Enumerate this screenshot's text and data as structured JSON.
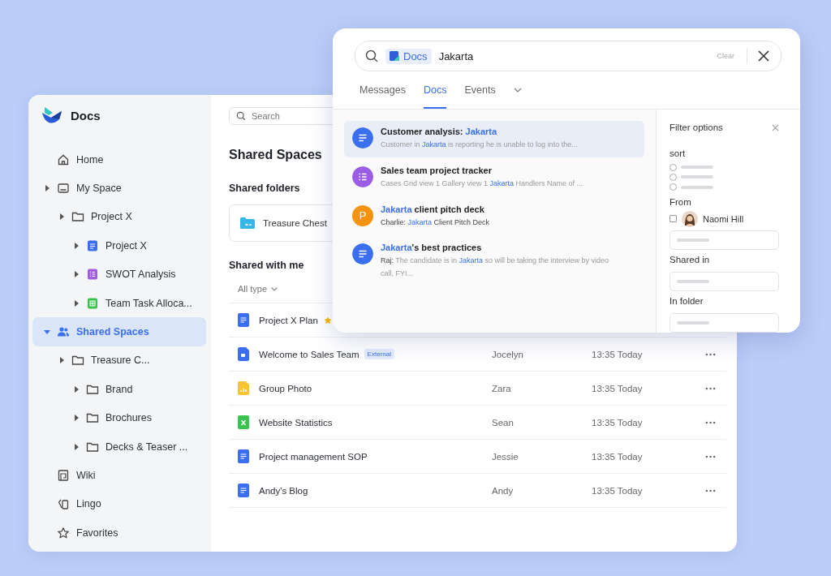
{
  "app": {
    "name": "Docs"
  },
  "sidebar": {
    "items": [
      {
        "label": "Home",
        "kind": "home",
        "selected": false
      },
      {
        "label": "My Space",
        "kind": "space",
        "selected": false,
        "expanded": false,
        "children": [
          {
            "label": "Project X",
            "kind": "folder",
            "selected": false,
            "expanded": false,
            "children": [
              {
                "label": "Project X",
                "kind": "doc",
                "selected": false,
                "expanded": false
              },
              {
                "label": "SWOT Analysis",
                "kind": "list",
                "selected": false,
                "expanded": false
              },
              {
                "label": "Team Task Alloca...",
                "kind": "sheet",
                "selected": false,
                "expanded": false
              }
            ]
          }
        ]
      },
      {
        "label": "Shared Spaces",
        "kind": "people",
        "selected": true,
        "expanded": true,
        "children": [
          {
            "label": "Treasure C...",
            "kind": "folder",
            "selected": false,
            "expanded": false,
            "children": [
              {
                "label": "Brand",
                "kind": "folder",
                "selected": false,
                "expanded": false
              },
              {
                "label": "Brochures",
                "kind": "folder",
                "selected": false,
                "expanded": false
              },
              {
                "label": "Decks & Teaser ...",
                "kind": "folder",
                "selected": false,
                "expanded": false
              }
            ]
          }
        ]
      },
      {
        "label": "Wiki",
        "kind": "wiki",
        "selected": false
      },
      {
        "label": "Lingo",
        "kind": "lingo",
        "selected": false
      },
      {
        "label": "Favorites",
        "kind": "star",
        "selected": false
      }
    ]
  },
  "main": {
    "search": {
      "placeholder": "Search"
    },
    "title": "Shared Spaces",
    "folders_heading": "Shared folders",
    "folders": [
      {
        "name": "Treasure Chest"
      }
    ],
    "shared_heading": "Shared with me",
    "type_filter": "All type",
    "rows": [
      {
        "kind": "doc",
        "name": "Project X Plan",
        "starred": true
      },
      {
        "kind": "slides",
        "name": "Welcome to Sales Team",
        "tag": "External",
        "starred": false,
        "owner": "Jocelyn",
        "time": "13:35 Today"
      },
      {
        "kind": "image",
        "name": "Group Photo",
        "starred": false,
        "owner": "Zara",
        "time": "13:35 Today"
      },
      {
        "kind": "sheet",
        "name": "Website Statistics",
        "starred": false,
        "owner": "Sean",
        "time": "13:35 Today"
      },
      {
        "kind": "doc",
        "name": "Project management SOP",
        "starred": false,
        "owner": "Jessie",
        "time": "13:35 Today"
      },
      {
        "kind": "doc",
        "name": "Andy's Blog",
        "starred": false,
        "owner": "Andy",
        "time": "13:35 Today"
      }
    ]
  },
  "search_popup": {
    "scope": "Docs",
    "query": "Jakarta",
    "clear": "Clear",
    "tabs": [
      {
        "label": "Messages",
        "selected": false
      },
      {
        "label": "Docs",
        "selected": true
      },
      {
        "label": "Events",
        "selected": false
      }
    ],
    "results": [
      {
        "kind": "doc",
        "color": "#3b6ff0",
        "selected": true,
        "title": [
          {
            "text": "Customer analysis: ",
            "kind": "text"
          },
          {
            "text": "Jakarta",
            "kind": "match"
          }
        ],
        "snippet": [
          {
            "text": "Customer in ",
            "kind": "text"
          },
          {
            "text": "Jakarta",
            "kind": "match"
          },
          {
            "text": " is reporting he is unable to log into the...",
            "kind": "text"
          }
        ]
      },
      {
        "kind": "list",
        "color": "#9b5de5",
        "selected": false,
        "title": [
          {
            "text": "Sales team project tracker",
            "kind": "text"
          }
        ],
        "snippet": [
          {
            "text": "Cases Grid view 1 Gallery view 1 ",
            "kind": "text"
          },
          {
            "text": "Jakarta",
            "kind": "match"
          },
          {
            "text": " Handlers Name of ...",
            "kind": "text"
          }
        ]
      },
      {
        "kind": "letter",
        "letter": "P",
        "color": "#f5930f",
        "selected": false,
        "title": [
          {
            "text": "Jakarta",
            "kind": "match"
          },
          {
            "text": " client pitch deck",
            "kind": "text"
          }
        ],
        "snippet": [
          {
            "text": "Charlie: ",
            "kind": "author"
          },
          {
            "text": "Jakarta",
            "kind": "match"
          },
          {
            "text": " Client Pitch Deck",
            "kind": "author"
          }
        ]
      },
      {
        "kind": "doc",
        "color": "#3b6ff0",
        "selected": false,
        "title": [
          {
            "text": "Jakarta",
            "kind": "match"
          },
          {
            "text": "'s best practices",
            "kind": "text"
          }
        ],
        "snippet": [
          {
            "text": "Raj:",
            "kind": "author"
          },
          {
            "text": " The candidate is in ",
            "kind": "text"
          },
          {
            "text": "Jakarta",
            "kind": "match"
          },
          {
            "text": " so will be taking the interview by video call, FYI...",
            "kind": "text"
          }
        ]
      }
    ],
    "filter": {
      "title": "Filter options",
      "sort_label": "sort",
      "sort_options": [
        {
          "checked": false
        },
        {
          "checked": false
        },
        {
          "checked": false
        }
      ],
      "from_label": "From",
      "people": [
        {
          "name": "Naomi Hill",
          "checked": false
        }
      ],
      "shared_in_label": "Shared in",
      "folder_label": "In folder"
    }
  }
}
